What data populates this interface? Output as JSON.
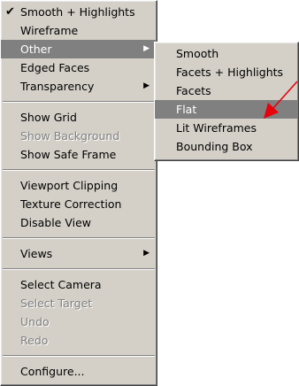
{
  "main_menu": {
    "group1": [
      {
        "label": "Smooth + Highlights",
        "checked": true
      },
      {
        "label": "Wireframe"
      },
      {
        "label": "Other",
        "highlighted": true,
        "submenu": true
      },
      {
        "label": "Edged Faces"
      },
      {
        "label": "Transparency",
        "submenu": true
      }
    ],
    "group2": [
      {
        "label": "Show Grid"
      },
      {
        "label": "Show Background",
        "disabled": true
      },
      {
        "label": "Show Safe Frame"
      }
    ],
    "group3": [
      {
        "label": "Viewport Clipping"
      },
      {
        "label": "Texture Correction"
      },
      {
        "label": "Disable View"
      }
    ],
    "group4": [
      {
        "label": "Views",
        "submenu": true
      }
    ],
    "group5": [
      {
        "label": "Select Camera"
      },
      {
        "label": "Select Target",
        "disabled": true
      },
      {
        "label": "Undo",
        "disabled": true
      },
      {
        "label": "Redo",
        "disabled": true
      }
    ],
    "group6": [
      {
        "label": "Configure..."
      }
    ]
  },
  "sub_menu": [
    {
      "label": "Smooth"
    },
    {
      "label": "Facets + Highlights"
    },
    {
      "label": "Facets"
    },
    {
      "label": "Flat",
      "highlighted": true
    },
    {
      "label": "Lit Wireframes"
    },
    {
      "label": "Bounding Box"
    }
  ],
  "colors": {
    "menu_bg": "#d4d0c8",
    "highlight": "#808080",
    "annotation_arrow": "#e8000b"
  },
  "icons": {
    "check": "check-icon",
    "submenu": "submenu-arrow-icon"
  }
}
